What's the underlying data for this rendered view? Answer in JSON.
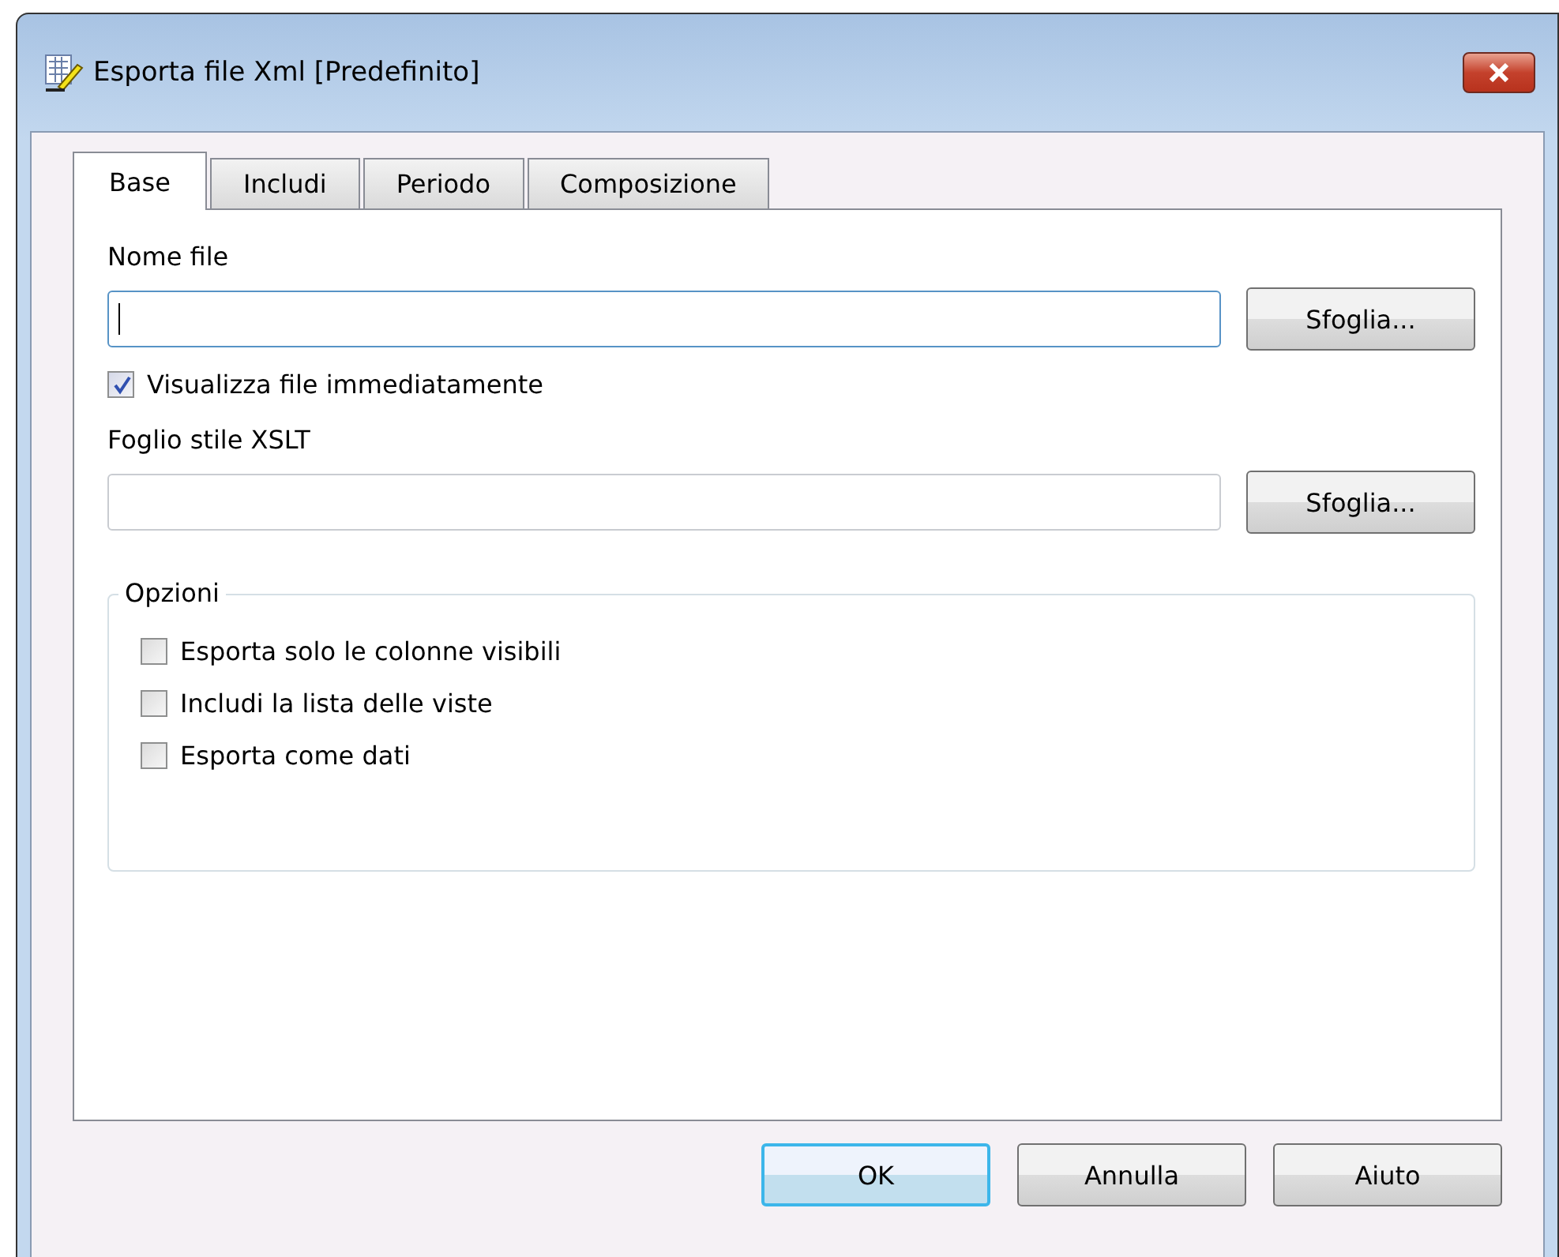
{
  "window": {
    "title": "Esporta file Xml [Predefinito]"
  },
  "tabs": [
    {
      "label": "Base",
      "selected": true
    },
    {
      "label": "Includi",
      "selected": false
    },
    {
      "label": "Periodo",
      "selected": false
    },
    {
      "label": "Composizione",
      "selected": false
    }
  ],
  "file_name": {
    "label": "Nome file",
    "focused": true,
    "browse": "Sfoglia..."
  },
  "show_file": {
    "label": "Visualizza file immediatamente",
    "checked": true
  },
  "stylesheet": {
    "label": "Foglio stile XSLT",
    "focused": false,
    "browse": "Sfoglia..."
  },
  "options": {
    "title": "Opzioni",
    "items": [
      {
        "label": "Esporta solo le colonne visibili",
        "checked": false
      },
      {
        "label": "Includi la lista delle viste",
        "checked": false
      },
      {
        "label": "Esporta come dati",
        "checked": false
      }
    ]
  },
  "buttons": [
    {
      "label": "OK",
      "default": true
    },
    {
      "label": "Annulla",
      "default": false
    },
    {
      "label": "Aiuto",
      "default": false
    }
  ]
}
